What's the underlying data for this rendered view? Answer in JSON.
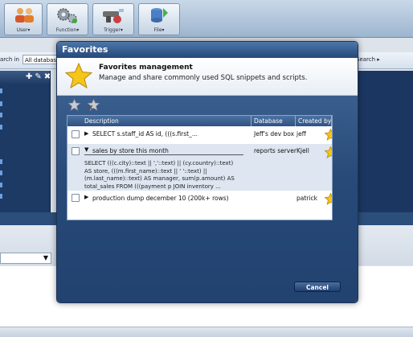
{
  "toolbar": {
    "buttons": [
      {
        "label": "User▾",
        "icon": "users-icon"
      },
      {
        "label": "Function▾",
        "icon": "gears-icon"
      },
      {
        "label": "Trigger▾",
        "icon": "trigger-icon"
      },
      {
        "label": "File▾",
        "icon": "database-file-icon"
      }
    ]
  },
  "search": {
    "left_label": "arch in",
    "combo_value": "All databas",
    "right_label": "Search ▸"
  },
  "dialog": {
    "title": "Favorites",
    "header_title": "Favorites management",
    "header_subtitle": "Manage and share commonly used SQL snippets and scripts.",
    "columns": {
      "description": "Description",
      "database": "Database",
      "created_by": "Created by"
    },
    "rows": [
      {
        "description": "SELECT s.staff_id AS id, (((s.first_...",
        "database": "Jeff's dev box",
        "created_by": "jeff",
        "expanded": false
      },
      {
        "description": "sales by store this month",
        "database": "reports server",
        "created_by": "Kjell",
        "expanded": true,
        "sql_lines": [
          "SELECT (((c.city)::text || ','::text) || (cy.country)::text)",
          "AS store, (((m.first_name)::text || ' '::text) ||",
          "(m.last_name)::text) AS manager, sum(p.amount) AS",
          "total_sales FROM (((payment p JOIN inventory ..."
        ]
      },
      {
        "description": "production dump december 10 (200k+ rows)",
        "database": "",
        "created_by": "patrick",
        "expanded": false
      }
    ],
    "cancel_label": "Cancel"
  },
  "colors": {
    "title_bar": "#24497a",
    "dialog_body": "#274a79",
    "star_fill": "#f5c518",
    "accent_blue": "#4d72a2"
  }
}
